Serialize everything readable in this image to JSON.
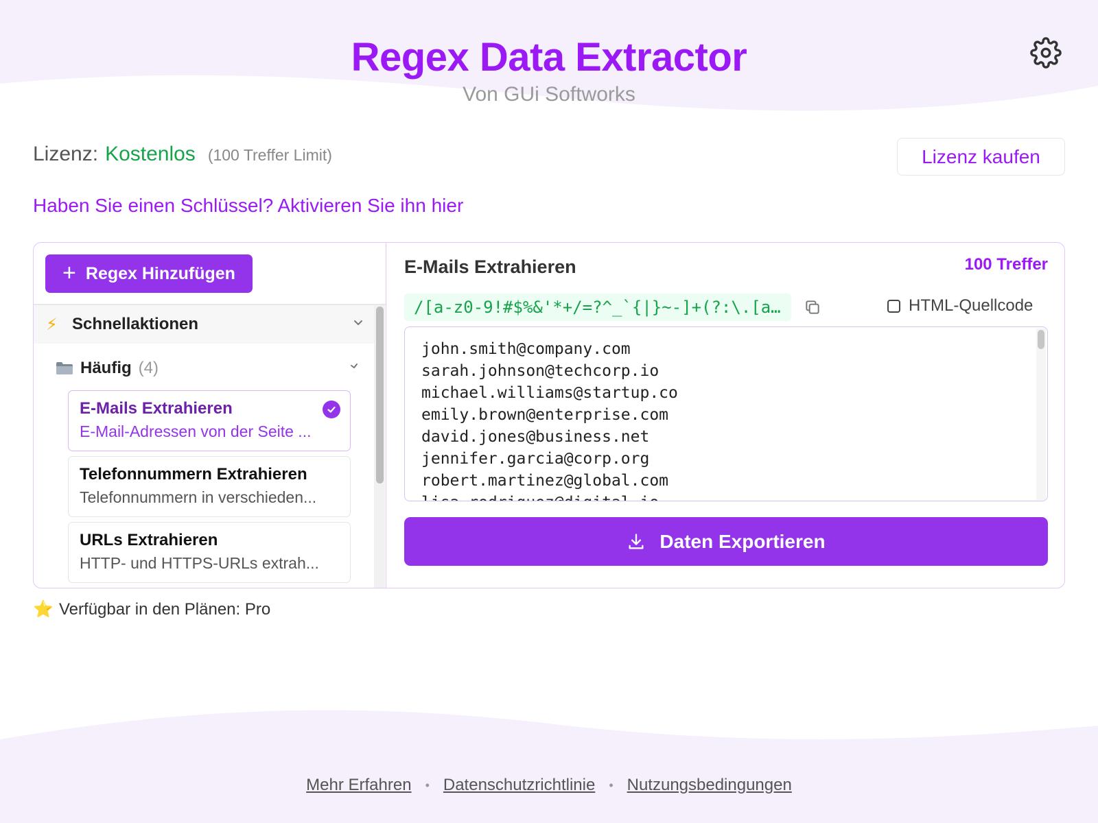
{
  "header": {
    "title": "Regex Data Extractor",
    "subtitle": "Von GUi Softworks"
  },
  "license": {
    "label": "Lizenz:",
    "value": "Kostenlos",
    "limit": "(100 Treffer Limit)",
    "buy_label": "Lizenz kaufen",
    "activate_link": "Haben Sie einen Schlüssel? Aktivieren Sie ihn hier"
  },
  "sidebar": {
    "add_button": "Regex Hinzufügen",
    "quick_actions": "Schnellaktionen",
    "folder": {
      "label": "Häufig",
      "count": "(4)"
    },
    "items": [
      {
        "title": "E-Mails Extrahieren",
        "desc": "E-Mail-Adressen von der Seite ...",
        "selected": true
      },
      {
        "title": "Telefonnummern Extrahieren",
        "desc": "Telefonnummern in verschieden..."
      },
      {
        "title": "URLs Extrahieren",
        "desc": "HTTP- und HTTPS-URLs extrah..."
      }
    ]
  },
  "main": {
    "regex_title": "E-Mails Extrahieren",
    "match_count": "100 Treffer",
    "regex_code": "/[a-z0-9!#$%&'*+/=?^_`{|}~-]+(?:\\.[a…",
    "html_toggle_label": "HTML-Quellcode",
    "results": [
      "john.smith@company.com",
      "sarah.johnson@techcorp.io",
      "michael.williams@startup.co",
      "emily.brown@enterprise.com",
      "david.jones@business.net",
      "jennifer.garcia@corp.org",
      "robert.martinez@global.com",
      "lisa.rodriguez@digital.io"
    ],
    "export_label": "Daten Exportieren"
  },
  "plans": {
    "label": "Verfügbar in den Plänen: Pro"
  },
  "footer": {
    "links": [
      "Mehr Erfahren",
      "Datenschutzrichtlinie",
      "Nutzungsbedingungen"
    ]
  },
  "colors": {
    "accent": "#9B19F5",
    "button": "#9333ea",
    "success": "#16a34a"
  },
  "icons": {
    "settings": "gear-icon",
    "add": "plus-icon",
    "quick_actions": "lightning-icon",
    "folder": "folder-icon",
    "selected": "check-circle-icon",
    "copy": "copy-icon",
    "export": "download-icon",
    "plans": "star-icon"
  }
}
